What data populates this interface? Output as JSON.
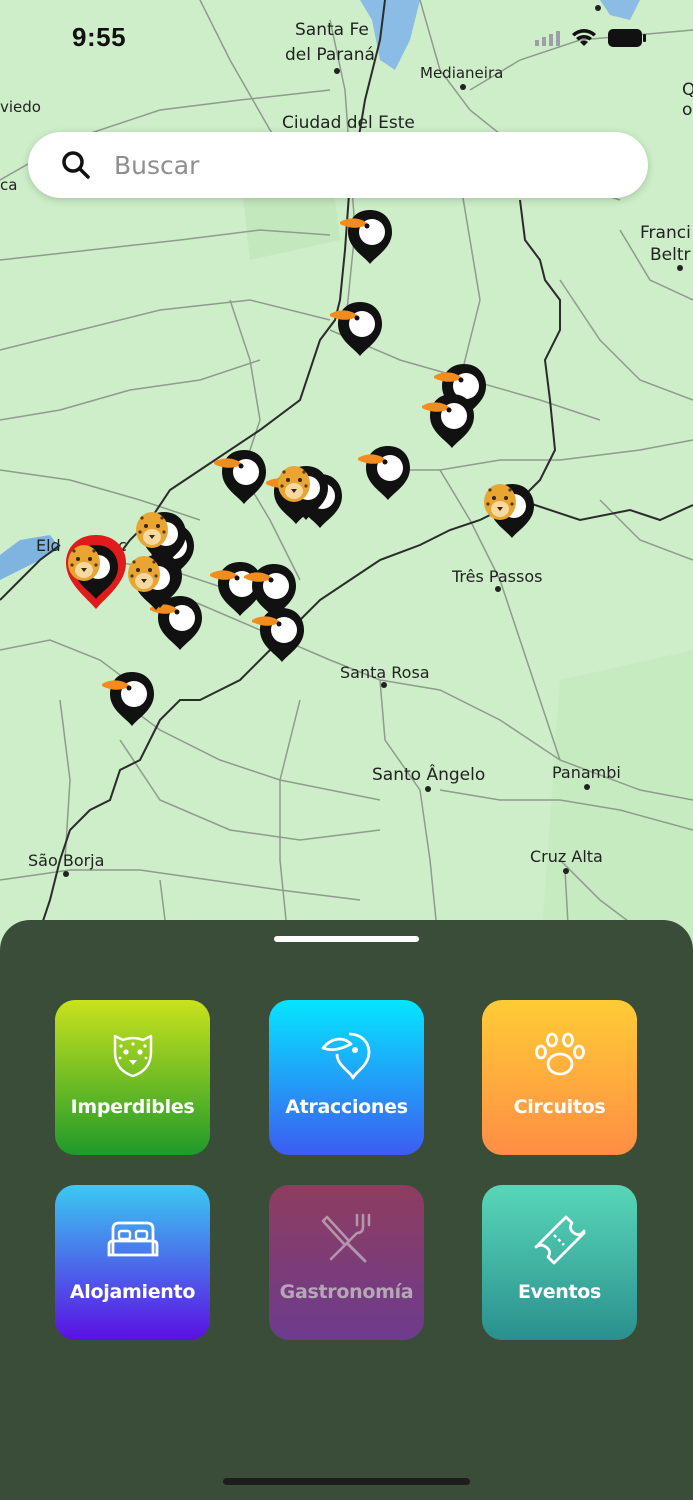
{
  "status": {
    "time": "9:55"
  },
  "search": {
    "placeholder": "Buscar"
  },
  "map": {
    "labels": [
      "Santa Fe",
      "del Paraná",
      "Medianeira",
      "Ciudad del Este",
      "viedo",
      "ca",
      "Franci",
      "Beltr",
      "Q",
      "o",
      "Três Passos",
      "Santa Rosa",
      "Santo Ângelo",
      "Panambi",
      "São Borja",
      "Cruz Alta",
      "Eld",
      "c"
    ],
    "markers": [
      "toucan",
      "jaguar",
      "selected-jaguar"
    ]
  },
  "categories": [
    {
      "label": "Imperdibles",
      "icon": "jaguar-icon",
      "colors": [
        "#c9e21d",
        "#1f9a2b"
      ]
    },
    {
      "label": "Atracciones",
      "icon": "toucan-icon",
      "colors": [
        "#05e5ff",
        "#3d5cf2"
      ]
    },
    {
      "label": "Circuitos",
      "icon": "paw-icon",
      "colors": [
        "#ffcc35",
        "#ff8d46"
      ]
    },
    {
      "label": "Alojamiento",
      "icon": "bed-icon",
      "colors": [
        "#3bc9f2",
        "#5b10e3"
      ]
    },
    {
      "label": "Gastronomía",
      "icon": "utensils-icon",
      "colors": [
        "#8e3d5f",
        "#6c3c8e"
      ]
    },
    {
      "label": "Eventos",
      "icon": "ticket-icon",
      "colors": [
        "#58d7b8",
        "#2a908e"
      ]
    }
  ]
}
